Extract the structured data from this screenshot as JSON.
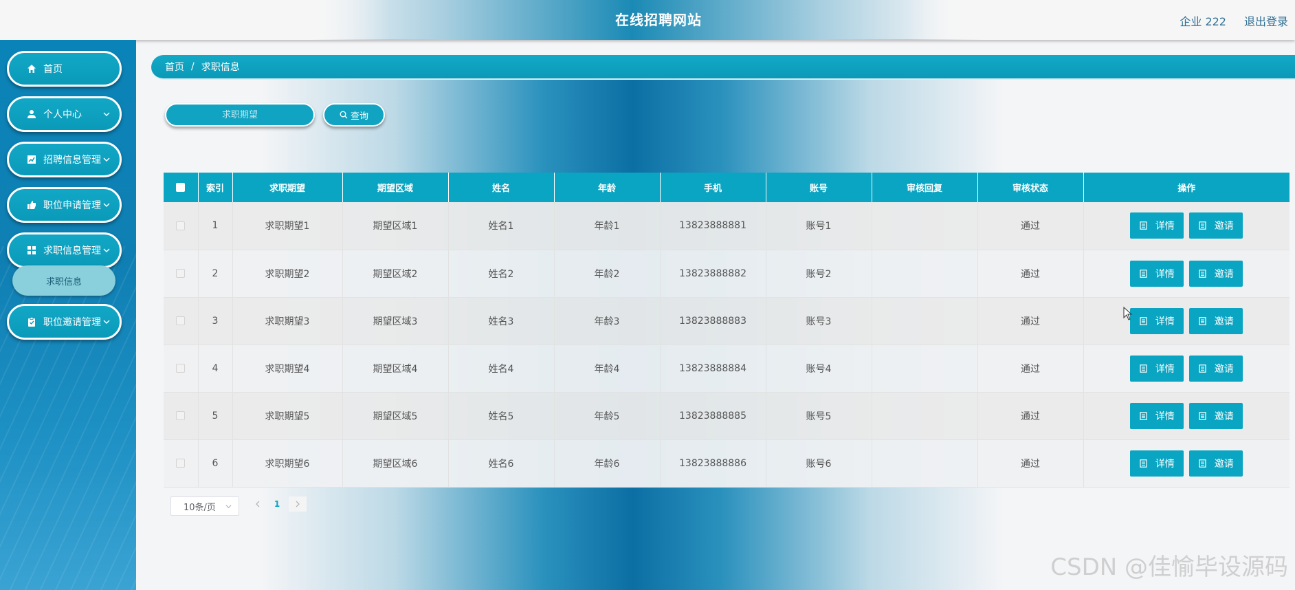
{
  "header": {
    "title": "在线招聘网站",
    "user": "企业 222",
    "logout": "退出登录"
  },
  "sidebar": {
    "items": [
      {
        "label": "首页",
        "icon": "home-icon"
      },
      {
        "label": "个人中心",
        "icon": "user-icon"
      },
      {
        "label": "招聘信息管理",
        "icon": "chart-icon"
      },
      {
        "label": "职位申请管理",
        "icon": "thumbs-up-icon"
      },
      {
        "label": "求职信息管理",
        "icon": "grid-icon"
      },
      {
        "label": "职位邀请管理",
        "icon": "clipboard-icon"
      }
    ],
    "active_sub": "求职信息"
  },
  "breadcrumb": {
    "home": "首页",
    "separator": "/",
    "current": "求职信息"
  },
  "search": {
    "placeholder": "求职期望",
    "button": "查询"
  },
  "table": {
    "columns": [
      "索引",
      "求职期望",
      "期望区域",
      "姓名",
      "年龄",
      "手机",
      "账号",
      "审核回复",
      "审核状态",
      "操作"
    ],
    "rows": [
      {
        "index": "1",
        "expect": "求职期望1",
        "region": "期望区域1",
        "name": "姓名1",
        "age": "年龄1",
        "phone": "13823888881",
        "account": "账号1",
        "reply": "",
        "status": "通过"
      },
      {
        "index": "2",
        "expect": "求职期望2",
        "region": "期望区域2",
        "name": "姓名2",
        "age": "年龄2",
        "phone": "13823888882",
        "account": "账号2",
        "reply": "",
        "status": "通过"
      },
      {
        "index": "3",
        "expect": "求职期望3",
        "region": "期望区域3",
        "name": "姓名3",
        "age": "年龄3",
        "phone": "13823888883",
        "account": "账号3",
        "reply": "",
        "status": "通过"
      },
      {
        "index": "4",
        "expect": "求职期望4",
        "region": "期望区域4",
        "name": "姓名4",
        "age": "年龄4",
        "phone": "13823888884",
        "account": "账号4",
        "reply": "",
        "status": "通过"
      },
      {
        "index": "5",
        "expect": "求职期望5",
        "region": "期望区域5",
        "name": "姓名5",
        "age": "年龄5",
        "phone": "13823888885",
        "account": "账号5",
        "reply": "",
        "status": "通过"
      },
      {
        "index": "6",
        "expect": "求职期望6",
        "region": "期望区域6",
        "name": "姓名6",
        "age": "年龄6",
        "phone": "13823888886",
        "account": "账号6",
        "reply": "",
        "status": "通过"
      }
    ],
    "actions": {
      "detail": "详情",
      "invite": "邀请"
    }
  },
  "pagination": {
    "page_size": "10条/页",
    "current_page": "1"
  },
  "watermark": "CSDN @佳愉毕设源码",
  "colors": {
    "accent": "#0aa5c2",
    "sidebar": "#0f7fb3",
    "header_user": "#2f6f94"
  }
}
